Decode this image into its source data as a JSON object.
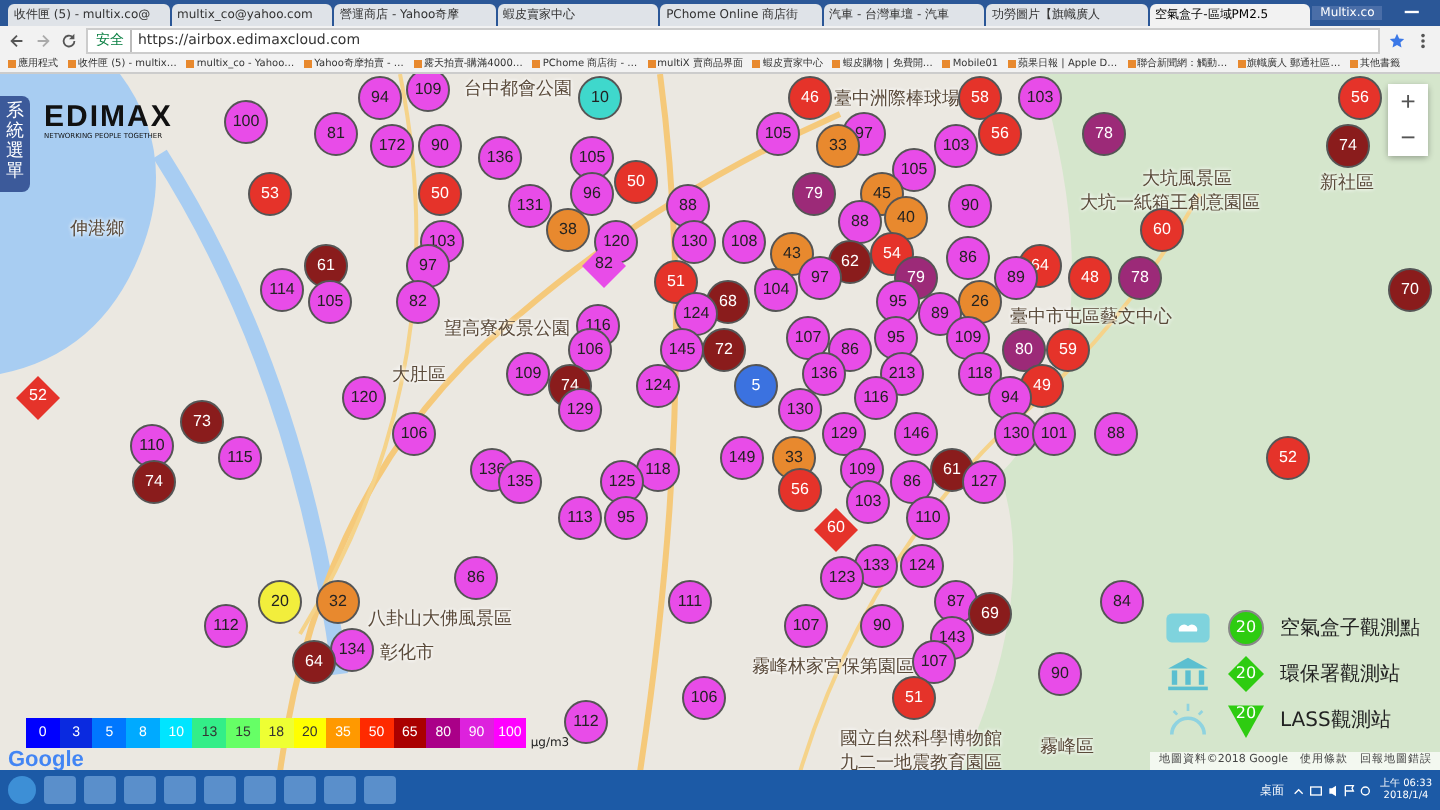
{
  "browser": {
    "tabs": [
      {
        "title": "收件匣 (5) - multix.co@",
        "selected": false
      },
      {
        "title": "multix_co@yahoo.com",
        "selected": false
      },
      {
        "title": "營運商店 - Yahoo奇摩",
        "selected": false
      },
      {
        "title": "蝦皮賣家中心",
        "selected": false
      },
      {
        "title": "PChome Online 商店街",
        "selected": false
      },
      {
        "title": "汽車 - 台灣車壇 - 汽車",
        "selected": false
      },
      {
        "title": "功勞圖片【旗幟廣人",
        "selected": false
      },
      {
        "title": "空氣盒子-區域PM2.5",
        "selected": true
      }
    ],
    "profile_name": "Multix.co",
    "address": {
      "secure_label": "安全",
      "url": "https://airbox.edimaxcloud.com"
    },
    "bookmarks": [
      "應用程式",
      "收件匣 (5) - multix…",
      "multix_co - Yahoo…",
      "Yahoo奇摩拍賣 - …",
      "露天拍賣-購滿4000…",
      "PChome 商店街 - …",
      "multiX 賣商品界面",
      "蝦皮賣家中心",
      "蝦皮購物 | 免費開…",
      "Mobile01",
      "蘋果日報 | Apple D…",
      "聯合新聞網：觸動…",
      "旗幟廣人 郵通社區…",
      "其他書籤"
    ]
  },
  "page": {
    "side_menu_label": "系統選單",
    "logo": {
      "name": "EDIMAX",
      "tagline": "NETWORKING PEOPLE TOGETHER"
    },
    "map": {
      "labels": [
        "台中都會公園",
        "臺中洲際棒球場",
        "伸港鄉",
        "望高寮夜景公園",
        "大肚區",
        "大坑風景區",
        "大坑一紙箱王創意園區",
        "臺中市屯區藝文中心",
        "新社區",
        "八卦山大佛風景區",
        "彰化市",
        "霧峰林家宮保第園區",
        "國立自然科學博物館",
        "九二一地震教育園區",
        "霧峰區"
      ],
      "markers": [
        {
          "value": "109",
          "color": "#e84ce8",
          "kind": "circle"
        },
        {
          "value": "94",
          "color": "#e84ce8",
          "kind": "circle"
        },
        {
          "value": "10",
          "color": "#3fd8cc",
          "kind": "circle"
        },
        {
          "value": "46",
          "color": "#e5332a",
          "kind": "circle"
        },
        {
          "value": "58",
          "color": "#e5332a",
          "kind": "circle"
        },
        {
          "value": "103",
          "color": "#e84ce8",
          "kind": "circle"
        },
        {
          "value": "56",
          "color": "#e5332a",
          "kind": "circle"
        },
        {
          "value": "100",
          "color": "#e84ce8",
          "kind": "circle"
        },
        {
          "value": "81",
          "color": "#e84ce8",
          "kind": "circle"
        },
        {
          "value": "105",
          "color": "#e84ce8",
          "kind": "circle"
        },
        {
          "value": "97",
          "color": "#e84ce8",
          "kind": "circle"
        },
        {
          "value": "56",
          "color": "#e5332a",
          "kind": "circle"
        },
        {
          "value": "78",
          "color": "#9c2a78",
          "kind": "circle"
        },
        {
          "value": "172",
          "color": "#e84ce8",
          "kind": "circle"
        },
        {
          "value": "90",
          "color": "#e84ce8",
          "kind": "circle"
        },
        {
          "value": "33",
          "color": "#e8892e",
          "kind": "circle"
        },
        {
          "value": "103",
          "color": "#e84ce8",
          "kind": "circle"
        },
        {
          "value": "74",
          "color": "#8a1c1c",
          "kind": "circle"
        },
        {
          "value": "136",
          "color": "#e84ce8",
          "kind": "circle"
        },
        {
          "value": "105",
          "color": "#e84ce8",
          "kind": "circle"
        },
        {
          "value": "105",
          "color": "#e84ce8",
          "kind": "circle"
        },
        {
          "value": "50",
          "color": "#e5332a",
          "kind": "circle"
        },
        {
          "value": "53",
          "color": "#e5332a",
          "kind": "circle"
        },
        {
          "value": "50",
          "color": "#e5332a",
          "kind": "circle"
        },
        {
          "value": "96",
          "color": "#e84ce8",
          "kind": "circle"
        },
        {
          "value": "79",
          "color": "#9c2a78",
          "kind": "circle"
        },
        {
          "value": "45",
          "color": "#e8892e",
          "kind": "circle"
        },
        {
          "value": "131",
          "color": "#e84ce8",
          "kind": "circle"
        },
        {
          "value": "88",
          "color": "#e84ce8",
          "kind": "circle"
        },
        {
          "value": "90",
          "color": "#e84ce8",
          "kind": "circle"
        },
        {
          "value": "88",
          "color": "#e84ce8",
          "kind": "circle"
        },
        {
          "value": "40",
          "color": "#e8892e",
          "kind": "circle"
        },
        {
          "value": "38",
          "color": "#e8892e",
          "kind": "circle"
        },
        {
          "value": "60",
          "color": "#e5332a",
          "kind": "circle"
        },
        {
          "value": "103",
          "color": "#e84ce8",
          "kind": "circle"
        },
        {
          "value": "120",
          "color": "#e84ce8",
          "kind": "circle"
        },
        {
          "value": "130",
          "color": "#e84ce8",
          "kind": "circle"
        },
        {
          "value": "108",
          "color": "#e84ce8",
          "kind": "circle"
        },
        {
          "value": "43",
          "color": "#e8892e",
          "kind": "circle"
        },
        {
          "value": "62",
          "color": "#8a1c1c",
          "kind": "circle"
        },
        {
          "value": "54",
          "color": "#e5332a",
          "kind": "circle"
        },
        {
          "value": "61",
          "color": "#8a1c1c",
          "kind": "circle"
        },
        {
          "value": "97",
          "color": "#e84ce8",
          "kind": "circle"
        },
        {
          "value": "82",
          "color": "#e84ce8",
          "kind": "diamond"
        },
        {
          "value": "86",
          "color": "#e84ce8",
          "kind": "circle"
        },
        {
          "value": "64",
          "color": "#e5332a",
          "kind": "circle"
        },
        {
          "value": "51",
          "color": "#e5332a",
          "kind": "circle"
        },
        {
          "value": "97",
          "color": "#e84ce8",
          "kind": "circle"
        },
        {
          "value": "79",
          "color": "#9c2a78",
          "kind": "circle"
        },
        {
          "value": "89",
          "color": "#e84ce8",
          "kind": "circle"
        },
        {
          "value": "48",
          "color": "#e5332a",
          "kind": "circle"
        },
        {
          "value": "78",
          "color": "#9c2a78",
          "kind": "circle"
        },
        {
          "value": "114",
          "color": "#e84ce8",
          "kind": "circle"
        },
        {
          "value": "104",
          "color": "#e84ce8",
          "kind": "circle"
        },
        {
          "value": "70",
          "color": "#8a1c1c",
          "kind": "circle"
        },
        {
          "value": "105",
          "color": "#e84ce8",
          "kind": "circle"
        },
        {
          "value": "82",
          "color": "#e84ce8",
          "kind": "circle"
        },
        {
          "value": "68",
          "color": "#8a1c1c",
          "kind": "circle"
        },
        {
          "value": "95",
          "color": "#e84ce8",
          "kind": "circle"
        },
        {
          "value": "26",
          "color": "#e8892e",
          "kind": "circle"
        },
        {
          "value": "124",
          "color": "#e84ce8",
          "kind": "circle"
        },
        {
          "value": "89",
          "color": "#e84ce8",
          "kind": "circle"
        },
        {
          "value": "116",
          "color": "#e84ce8",
          "kind": "circle"
        },
        {
          "value": "107",
          "color": "#e84ce8",
          "kind": "circle"
        },
        {
          "value": "95",
          "color": "#e84ce8",
          "kind": "circle"
        },
        {
          "value": "109",
          "color": "#e84ce8",
          "kind": "circle"
        },
        {
          "value": "106",
          "color": "#e84ce8",
          "kind": "circle"
        },
        {
          "value": "145",
          "color": "#e84ce8",
          "kind": "circle"
        },
        {
          "value": "72",
          "color": "#8a1c1c",
          "kind": "circle"
        },
        {
          "value": "86",
          "color": "#e84ce8",
          "kind": "circle"
        },
        {
          "value": "80",
          "color": "#9c2a78",
          "kind": "circle"
        },
        {
          "value": "59",
          "color": "#e5332a",
          "kind": "circle"
        },
        {
          "value": "109",
          "color": "#e84ce8",
          "kind": "circle"
        },
        {
          "value": "136",
          "color": "#e84ce8",
          "kind": "circle"
        },
        {
          "value": "213",
          "color": "#e84ce8",
          "kind": "circle"
        },
        {
          "value": "118",
          "color": "#e84ce8",
          "kind": "circle"
        },
        {
          "value": "74",
          "color": "#8a1c1c",
          "kind": "circle"
        },
        {
          "value": "124",
          "color": "#e84ce8",
          "kind": "circle"
        },
        {
          "value": "5",
          "color": "#3b72e0",
          "kind": "circle"
        },
        {
          "value": "49",
          "color": "#e5332a",
          "kind": "circle"
        },
        {
          "value": "52",
          "color": "#e5332a",
          "kind": "diamond"
        },
        {
          "value": "120",
          "color": "#e84ce8",
          "kind": "circle"
        },
        {
          "value": "116",
          "color": "#e84ce8",
          "kind": "circle"
        },
        {
          "value": "94",
          "color": "#e84ce8",
          "kind": "circle"
        },
        {
          "value": "129",
          "color": "#e84ce8",
          "kind": "circle"
        },
        {
          "value": "130",
          "color": "#e84ce8",
          "kind": "circle"
        },
        {
          "value": "73",
          "color": "#8a1c1c",
          "kind": "circle"
        },
        {
          "value": "106",
          "color": "#e84ce8",
          "kind": "circle"
        },
        {
          "value": "129",
          "color": "#e84ce8",
          "kind": "circle"
        },
        {
          "value": "146",
          "color": "#e84ce8",
          "kind": "circle"
        },
        {
          "value": "130",
          "color": "#e84ce8",
          "kind": "circle"
        },
        {
          "value": "101",
          "color": "#e84ce8",
          "kind": "circle"
        },
        {
          "value": "88",
          "color": "#e84ce8",
          "kind": "circle"
        },
        {
          "value": "110",
          "color": "#e84ce8",
          "kind": "circle"
        },
        {
          "value": "115",
          "color": "#e84ce8",
          "kind": "circle"
        },
        {
          "value": "149",
          "color": "#e84ce8",
          "kind": "circle"
        },
        {
          "value": "33",
          "color": "#e8892e",
          "kind": "circle"
        },
        {
          "value": "52",
          "color": "#e5332a",
          "kind": "circle"
        },
        {
          "value": "136",
          "color": "#e84ce8",
          "kind": "circle"
        },
        {
          "value": "118",
          "color": "#e84ce8",
          "kind": "circle"
        },
        {
          "value": "109",
          "color": "#e84ce8",
          "kind": "circle"
        },
        {
          "value": "61",
          "color": "#8a1c1c",
          "kind": "circle"
        },
        {
          "value": "74",
          "color": "#8a1c1c",
          "kind": "circle"
        },
        {
          "value": "135",
          "color": "#e84ce8",
          "kind": "circle"
        },
        {
          "value": "125",
          "color": "#e84ce8",
          "kind": "circle"
        },
        {
          "value": "56",
          "color": "#e5332a",
          "kind": "circle"
        },
        {
          "value": "86",
          "color": "#e84ce8",
          "kind": "circle"
        },
        {
          "value": "127",
          "color": "#e84ce8",
          "kind": "circle"
        },
        {
          "value": "103",
          "color": "#e84ce8",
          "kind": "circle"
        },
        {
          "value": "113",
          "color": "#e84ce8",
          "kind": "circle"
        },
        {
          "value": "95",
          "color": "#e84ce8",
          "kind": "circle"
        },
        {
          "value": "110",
          "color": "#e84ce8",
          "kind": "circle"
        },
        {
          "value": "60",
          "color": "#e5332a",
          "kind": "diamond"
        },
        {
          "value": "133",
          "color": "#e84ce8",
          "kind": "circle"
        },
        {
          "value": "124",
          "color": "#e84ce8",
          "kind": "circle"
        },
        {
          "value": "86",
          "color": "#e84ce8",
          "kind": "circle"
        },
        {
          "value": "123",
          "color": "#e84ce8",
          "kind": "circle"
        },
        {
          "value": "20",
          "color": "#f2ee3c",
          "kind": "circle"
        },
        {
          "value": "32",
          "color": "#e8892e",
          "kind": "circle"
        },
        {
          "value": "111",
          "color": "#e84ce8",
          "kind": "circle"
        },
        {
          "value": "87",
          "color": "#e84ce8",
          "kind": "circle"
        },
        {
          "value": "84",
          "color": "#e84ce8",
          "kind": "circle"
        },
        {
          "value": "69",
          "color": "#8a1c1c",
          "kind": "circle"
        },
        {
          "value": "112",
          "color": "#e84ce8",
          "kind": "circle"
        },
        {
          "value": "107",
          "color": "#e84ce8",
          "kind": "circle"
        },
        {
          "value": "90",
          "color": "#e84ce8",
          "kind": "circle"
        },
        {
          "value": "143",
          "color": "#e84ce8",
          "kind": "circle"
        },
        {
          "value": "134",
          "color": "#e84ce8",
          "kind": "circle"
        },
        {
          "value": "64",
          "color": "#8a1c1c",
          "kind": "circle"
        },
        {
          "value": "107",
          "color": "#e84ce8",
          "kind": "circle"
        },
        {
          "value": "90",
          "color": "#e84ce8",
          "kind": "circle"
        },
        {
          "value": "106",
          "color": "#e84ce8",
          "kind": "circle"
        },
        {
          "value": "51",
          "color": "#e5332a",
          "kind": "circle"
        },
        {
          "value": "112",
          "color": "#e84ce8",
          "kind": "circle"
        }
      ],
      "zoom_in": "+",
      "zoom_out": "−",
      "scale": {
        "steps": [
          {
            "label": "0",
            "color": "#0000ff"
          },
          {
            "label": "3",
            "color": "#0a2ae0"
          },
          {
            "label": "5",
            "color": "#0077ff"
          },
          {
            "label": "8",
            "color": "#00aaff"
          },
          {
            "label": "10",
            "color": "#00e5ff"
          },
          {
            "label": "13",
            "color": "#33ee88"
          },
          {
            "label": "15",
            "color": "#66ff66"
          },
          {
            "label": "18",
            "color": "#eeff33"
          },
          {
            "label": "20",
            "color": "#ffff00"
          },
          {
            "label": "35",
            "color": "#ff9900"
          },
          {
            "label": "50",
            "color": "#ff2a00"
          },
          {
            "label": "65",
            "color": "#aa0000"
          },
          {
            "label": "80",
            "color": "#aa0088"
          },
          {
            "label": "90",
            "color": "#dd22dd"
          },
          {
            "label": "100",
            "color": "#ff00ff"
          }
        ],
        "unit": "μg/m3"
      },
      "station_legend": [
        {
          "kind": "airbox",
          "badge": "20",
          "label": "空氣盒子觀測點"
        },
        {
          "kind": "epa",
          "badge": "20",
          "label": "環保署觀測站"
        },
        {
          "kind": "lass",
          "badge": "20",
          "label": "LASS觀測站"
        }
      ],
      "google_logo": "Google",
      "attribution": [
        "地圖資料©2018 Google",
        "使用條款",
        "回報地圖錯誤"
      ]
    }
  },
  "taskbar": {
    "desktop_label": "桌面",
    "time": "上午 06:33",
    "date": "2018/1/4"
  }
}
